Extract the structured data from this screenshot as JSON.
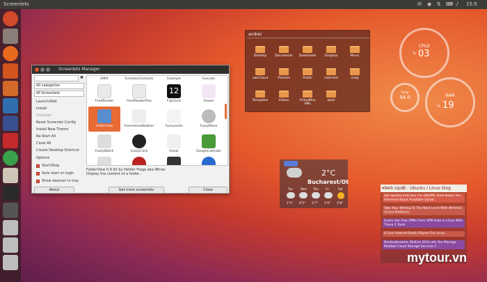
{
  "top_panel": {
    "title": "Screenlets",
    "time": "15:5"
  },
  "manager": {
    "title": "Screenlets Manager",
    "categories_select": "All categories",
    "screenlets_select": "All Screenlets",
    "actions": [
      "Launch/Add",
      "Install",
      "Uninstall",
      "Reset Screenlet Config",
      "Install New Theme",
      "Re-Start All",
      "Close All",
      "Create Desktop Shortcut",
      "Options"
    ],
    "checkboxes": [
      "Start/Stop",
      "Auto start on login",
      "Show daemon in tray"
    ],
    "columns": [
      "EMIX",
      "EvolutionContacts",
      "Example",
      "Execute"
    ],
    "row1": [
      "FeedReader",
      "FeedReaderPlus",
      "FlipClock",
      "Flower"
    ],
    "row2": [
      "FolderView",
      "FreemeteoWeather",
      "Funnyordie",
      "FuzzyMoon"
    ],
    "row3": [
      "FuzzyWatch",
      "FuzzyClock",
      "Gmail",
      "GoogleCalendar"
    ],
    "flipclock_digits": "12",
    "description": "FolderView 0.9.92 by Helder Fraga aka Whise",
    "description2": "Display the content of a folder...",
    "about": "About",
    "get_more": "Get more screenlets",
    "close": "Close"
  },
  "folderview": {
    "title": "andrei",
    "row1": [
      "Desktop",
      "Documents",
      "Downloads",
      "Dropbox",
      "Music"
    ],
    "row2": [
      "ownCloud",
      "Pictures",
      "Public",
      "rutorrent",
      "snap"
    ],
    "row3": [
      "Templates",
      "Videos",
      "VirtualBox VMs",
      "work"
    ]
  },
  "gauges": {
    "cpu": {
      "label": "CPU2",
      "unit": "%",
      "value": "03"
    },
    "ram": {
      "label": "RAM",
      "unit": "%",
      "value": "19"
    },
    "small": {
      "label": "Temp",
      "value": "54.0"
    }
  },
  "weather": {
    "temp": "2°C",
    "city": "Bucharest/Ot",
    "days": [
      "Tue",
      "Wed",
      "Thu",
      "Fri",
      "Sat"
    ],
    "temps": [
      "2°3°",
      "0°5°",
      "3°7°",
      "2°6°",
      "3°8°"
    ]
  },
  "rss": {
    "title": "Web UpdB - Ubuntu / Linux blog",
    "items": [
      "Apt Update Indicator For GNOME Shell Keeps You Informed About Available Updat...",
      "Take Your Writing To The Next Level With Writefull (Cross-Platform)",
      "Easily Use Free VPNs From VPN Gate In Linux With These 2 Tools",
      "6 Cool Internet Radio Players For Linux",
      "Nimbusbrowser (Rolline GUI) Lets You Manage Multiple Cloud Storage Services F..."
    ]
  },
  "watermark": "mytour.vn",
  "colors": {
    "accent": "#e05a2a",
    "panel": "#3c3b37",
    "folder": "#e9974a"
  }
}
